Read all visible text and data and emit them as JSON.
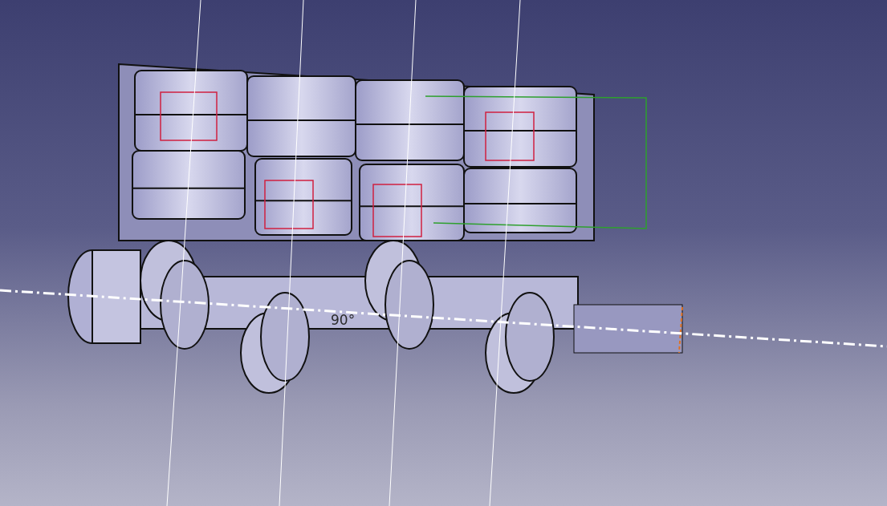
{
  "viewport": {
    "annotations": [
      {
        "kind": "angle",
        "text": "90°"
      }
    ]
  }
}
